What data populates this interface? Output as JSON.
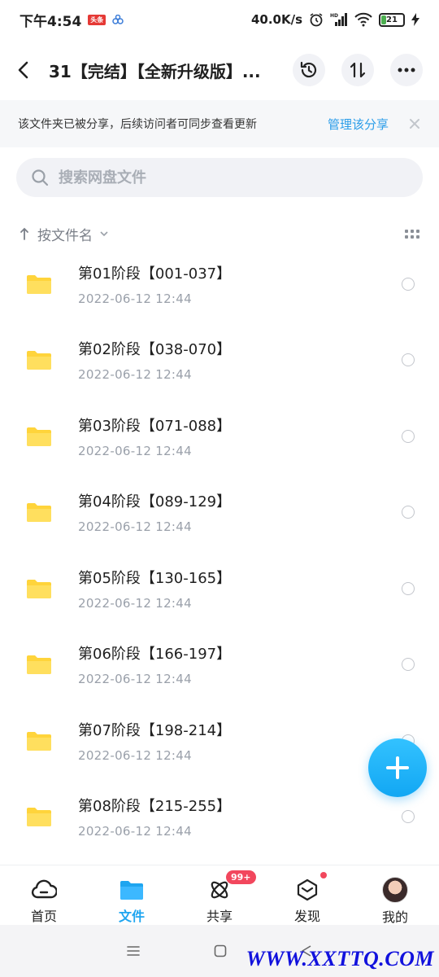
{
  "status_bar": {
    "time": "下午4:54",
    "app_chip": "头条",
    "net_speed": "40.0K/s",
    "battery": "21",
    "battery_level": 0.21
  },
  "header": {
    "title": "31【完结】【全新升级版】..."
  },
  "share_banner": {
    "text": "该文件夹已被分享，后续访问者可同步查看更新",
    "link": "管理该分享"
  },
  "search": {
    "placeholder": "搜索网盘文件"
  },
  "sort": {
    "label": "按文件名"
  },
  "files": [
    {
      "name": "第01阶段【001-037】",
      "date": "2022-06-12  12:44"
    },
    {
      "name": "第02阶段【038-070】",
      "date": "2022-06-12  12:44"
    },
    {
      "name": "第03阶段【071-088】",
      "date": "2022-06-12  12:44"
    },
    {
      "name": "第04阶段【089-129】",
      "date": "2022-06-12  12:44"
    },
    {
      "name": "第05阶段【130-165】",
      "date": "2022-06-12  12:44"
    },
    {
      "name": "第06阶段【166-197】",
      "date": "2022-06-12  12:44"
    },
    {
      "name": "第07阶段【198-214】",
      "date": "2022-06-12  12:44"
    },
    {
      "name": "第08阶段【215-255】",
      "date": "2022-06-12  12:44"
    }
  ],
  "tabs": [
    {
      "label": "首页",
      "icon": "cloud-icon"
    },
    {
      "label": "文件",
      "icon": "folder-icon"
    },
    {
      "label": "共享",
      "icon": "atom-icon",
      "badge": "99+"
    },
    {
      "label": "发现",
      "icon": "cube-icon"
    },
    {
      "label": "我的",
      "icon": "avatar"
    }
  ],
  "watermark": "WWW.XXTTQ.COM",
  "colors": {
    "accent": "#1ea5f0",
    "folder": "#ffd43b",
    "badge": "#f2475d",
    "link": "#2b9de9"
  }
}
